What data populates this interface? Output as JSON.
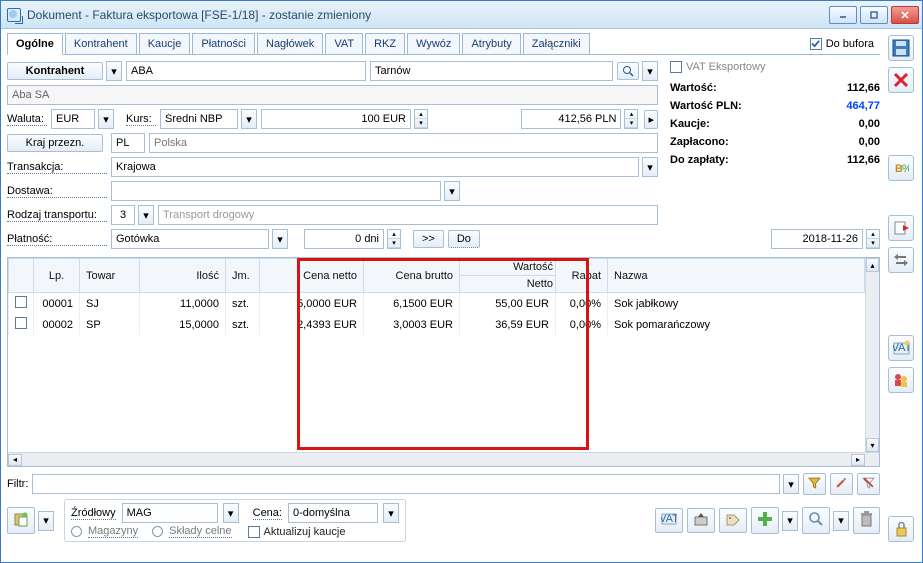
{
  "window": {
    "title": "Dokument - Faktura eksportowa [FSE-1/18]  - zostanie zmieniony"
  },
  "tabs": [
    "Ogólne",
    "Kontrahent",
    "Kaucje",
    "Płatności",
    "Nagłówek",
    "VAT",
    "RKZ",
    "Wywóz",
    "Atrybuty",
    "Załączniki"
  ],
  "do_bufora": "Do bufora",
  "kontrahent": {
    "button": "Kontrahent",
    "code": "ABA",
    "city": "Tarnów",
    "fullname": "Aba SA"
  },
  "vat_eksportowy": "VAT Eksportowy",
  "waluta": {
    "label": "Waluta:",
    "value": "EUR"
  },
  "kurs": {
    "label": "Kurs:",
    "type": "Średni NBP",
    "value": "100 EUR",
    "pln": "412,56 PLN"
  },
  "kraj": {
    "button": "Kraj przezn.",
    "code": "PL",
    "name": "Polska"
  },
  "transakcja": {
    "label": "Transakcja:",
    "value": "Krajowa"
  },
  "dostawa": {
    "label": "Dostawa:"
  },
  "rodzaj": {
    "label": "Rodzaj transportu:",
    "num": "3",
    "name": "Transport drogowy"
  },
  "platnosc": {
    "label": "Płatność:",
    "value": "Gotówka",
    "dni": "0 dni",
    "btn1": ">>",
    "btn2": "Do",
    "date": "2018-11-26"
  },
  "summary": {
    "wartosc": {
      "k": "Wartość:",
      "v": "112,66"
    },
    "wartosc_pln": {
      "k": "Wartość PLN:",
      "v": "464,77"
    },
    "kaucje": {
      "k": "Kaucje:",
      "v": "0,00"
    },
    "zaplacono": {
      "k": "Zapłacono:",
      "v": "0,00"
    },
    "do_zaplaty": {
      "k": "Do zapłaty:",
      "v": "112,66"
    }
  },
  "cols": {
    "lp": "Lp.",
    "towar": "Towar",
    "ilosc": "Ilość",
    "jm": "Jm.",
    "netto": "Cena netto",
    "brutto": "Cena brutto",
    "wartosc": "Wartość",
    "wartosc_netto": "Netto",
    "rabat": "Rabat",
    "nazwa": "Nazwa"
  },
  "rows": [
    {
      "lp": "00001",
      "towar": "SJ",
      "ilosc": "11,0000",
      "jm": "szt.",
      "netto": "5,0000 EUR",
      "brutto": "6,1500 EUR",
      "wartosc": "55,00 EUR",
      "rabat": "0,00%",
      "nazwa": "Sok jabłkowy"
    },
    {
      "lp": "00002",
      "towar": "SP",
      "ilosc": "15,0000",
      "jm": "szt.",
      "netto": "2,4393 EUR",
      "brutto": "3,0003 EUR",
      "wartosc": "36,59 EUR",
      "rabat": "0,00%",
      "nazwa": "Sok pomarańczowy"
    }
  ],
  "filtr": "Filtr:",
  "lower": {
    "zrodlowy": "Źródłowy",
    "mag": "MAG",
    "cena": "Cena:",
    "cena_val": "0-domyślna",
    "magazyny": "Magazyny",
    "sklady": "Składy celne",
    "aktualizuj": "Aktualizuj kaucje"
  }
}
